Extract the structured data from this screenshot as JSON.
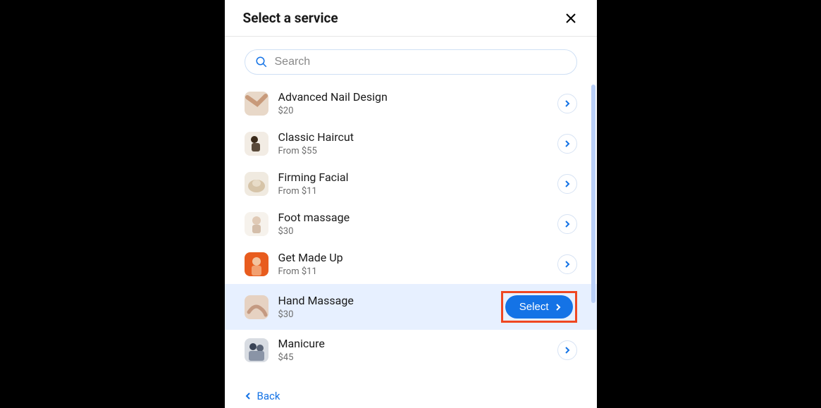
{
  "header": {
    "title": "Select a service"
  },
  "search": {
    "placeholder": "Search",
    "value": ""
  },
  "services": [
    {
      "name": "Advanced Nail Design",
      "price": "$20",
      "selected": false
    },
    {
      "name": "Classic Haircut",
      "price": "From $55",
      "selected": false
    },
    {
      "name": "Firming Facial",
      "price": "From $11",
      "selected": false
    },
    {
      "name": "Foot massage",
      "price": "$30",
      "selected": false
    },
    {
      "name": "Get Made Up",
      "price": "From $11",
      "selected": false
    },
    {
      "name": "Hand Massage",
      "price": "$30",
      "selected": true
    },
    {
      "name": "Manicure",
      "price": "$45",
      "selected": false
    }
  ],
  "buttons": {
    "select": "Select",
    "back": "Back"
  },
  "thumbs": [
    {
      "bg": "#e8d8c8",
      "accent": "#c89a7a"
    },
    {
      "bg": "#f2ece4",
      "accent": "#3a2a1a"
    },
    {
      "bg": "#f0eae0",
      "accent": "#d6c4a8"
    },
    {
      "bg": "#f6f2ec",
      "accent": "#c4a890"
    },
    {
      "bg": "#e85c1e",
      "accent": "#f2a070"
    },
    {
      "bg": "#e6d2c2",
      "accent": "#c49a82"
    },
    {
      "bg": "#d8dce2",
      "accent": "#3a4456"
    }
  ]
}
